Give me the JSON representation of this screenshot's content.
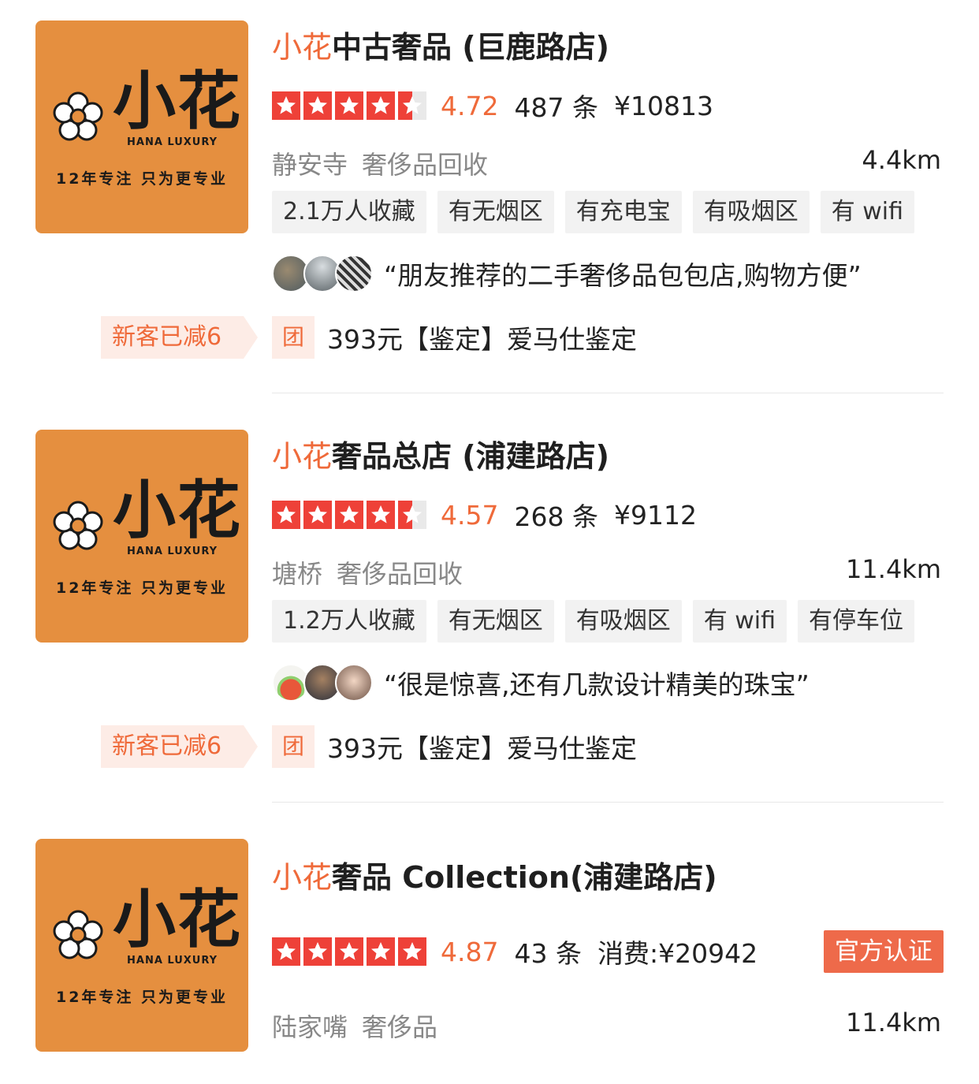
{
  "logo": {
    "brand_cn": "小花",
    "brand_en": "HANA LUXURY",
    "slogan": "12年专注 只为更专业"
  },
  "shops": [
    {
      "title_highlight": "小花",
      "title_rest": "中古奢品 (巨鹿路店)",
      "rating": 4.5,
      "score": "4.72",
      "reviews": "487 条",
      "price": "¥10813",
      "area": "静安寺",
      "category": "奢侈品回收",
      "distance": "4.4km",
      "tags": [
        "2.1万人收藏",
        "有无烟区",
        "有充电宝",
        "有吸烟区",
        "有 wifi"
      ],
      "quote": "“朋友推荐的二手奢侈品包包店,购物方便”",
      "promo": "新客已减6",
      "tuan_label": "团",
      "deal": "393元【鉴定】爱马仕鉴定"
    },
    {
      "title_highlight": "小花",
      "title_rest": "奢品总店 (浦建路店)",
      "rating": 4.5,
      "score": "4.57",
      "reviews": "268 条",
      "price": "¥9112",
      "area": "塘桥",
      "category": "奢侈品回收",
      "distance": "11.4km",
      "tags": [
        "1.2万人收藏",
        "有无烟区",
        "有吸烟区",
        "有 wifi",
        "有停车位"
      ],
      "quote": "“很是惊喜,还有几款设计精美的珠宝”",
      "promo": "新客已减6",
      "tuan_label": "团",
      "deal": "393元【鉴定】爱马仕鉴定"
    },
    {
      "title_highlight": "小花",
      "title_rest": "奢品 Collection(浦建路店)",
      "rating": 5,
      "score": "4.87",
      "reviews": "43 条",
      "price": "消费:¥20942",
      "official": "官方认证",
      "area": "陆家嘴",
      "category": "奢侈品",
      "distance": "11.4km"
    }
  ],
  "colors": {
    "accent": "#ef6a3a",
    "star": "#ee4138",
    "logo_bg": "#e58f3f"
  }
}
